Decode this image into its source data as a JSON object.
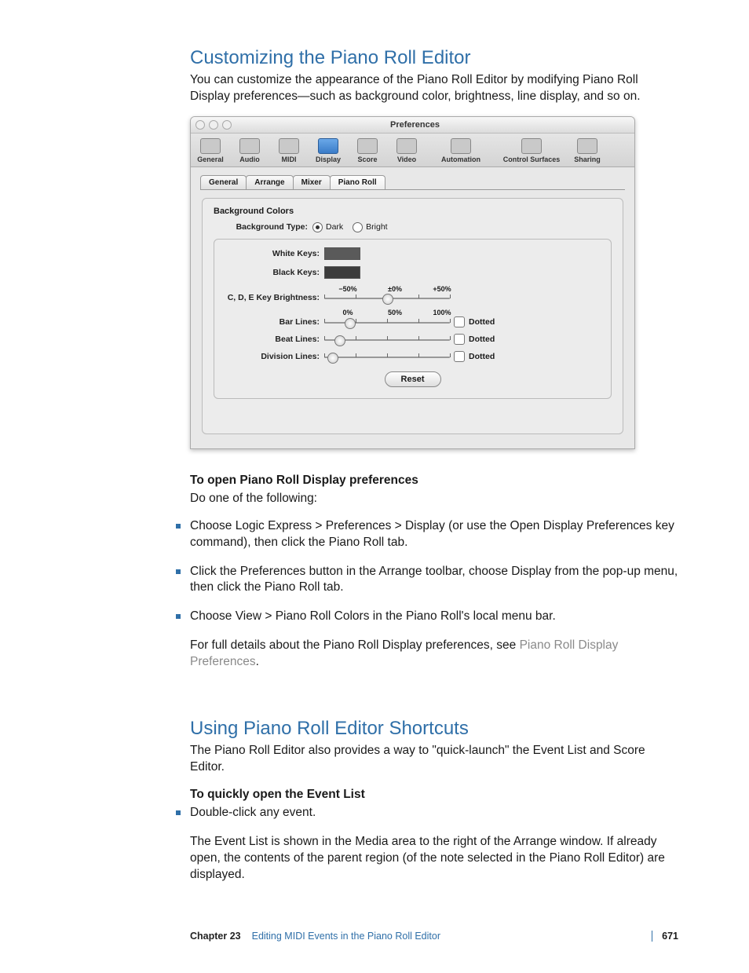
{
  "section1": {
    "heading": "Customizing the Piano Roll Editor",
    "intro": "You can customize the appearance of the Piano Roll Editor by modifying Piano Roll Display preferences—such as background color, brightness, line display, and so on.",
    "subA_bold": "To open Piano Roll Display preferences",
    "subA_line": "Do one of the following:",
    "bullets": [
      "Choose Logic Express > Preferences > Display (or use the Open Display Preferences key command), then click the Piano Roll tab.",
      "Click the Preferences button in the Arrange toolbar, choose Display from the pop-up menu, then click the Piano Roll tab.",
      "Choose View > Piano Roll Colors in the Piano Roll's local menu bar."
    ],
    "note_pre": "For full details about the Piano Roll Display preferences, see ",
    "note_link": "Piano Roll Display Preferences",
    "note_post": "."
  },
  "section2": {
    "heading": "Using Piano Roll Editor Shortcuts",
    "intro": "The Piano Roll Editor also provides a way to \"quick-launch\" the Event List and Score Editor.",
    "subA_bold": "To quickly open the Event List",
    "bullet1": "Double-click any event.",
    "para": "The Event List is shown in the Media area to the right of the Arrange window. If already open, the contents of the parent region (of the note selected in the Piano Roll Editor) are displayed."
  },
  "prefs": {
    "title": "Preferences",
    "toolbar": [
      "General",
      "Audio",
      "MIDI",
      "Display",
      "Score",
      "Video",
      "Automation",
      "Control Surfaces",
      "Sharing"
    ],
    "tabs": [
      "General",
      "Arrange",
      "Mixer",
      "Piano Roll"
    ],
    "group_title": "Background Colors",
    "bg_type_label": "Background Type:",
    "bg_opt_dark": "Dark",
    "bg_opt_bright": "Bright",
    "white_keys": "White Keys:",
    "black_keys": "Black Keys:",
    "brightness_label": "C, D, E Key Brightness:",
    "brightness_scale": [
      "−50%",
      "±0%",
      "+50%"
    ],
    "line_scale": [
      "0%",
      "50%",
      "100%"
    ],
    "bar_lines": "Bar Lines:",
    "beat_lines": "Beat Lines:",
    "division_lines": "Division Lines:",
    "dotted": "Dotted",
    "reset": "Reset"
  },
  "footer": {
    "chapter": "Chapter 23",
    "title": "Editing MIDI Events in the Piano Roll Editor",
    "page": "671"
  }
}
